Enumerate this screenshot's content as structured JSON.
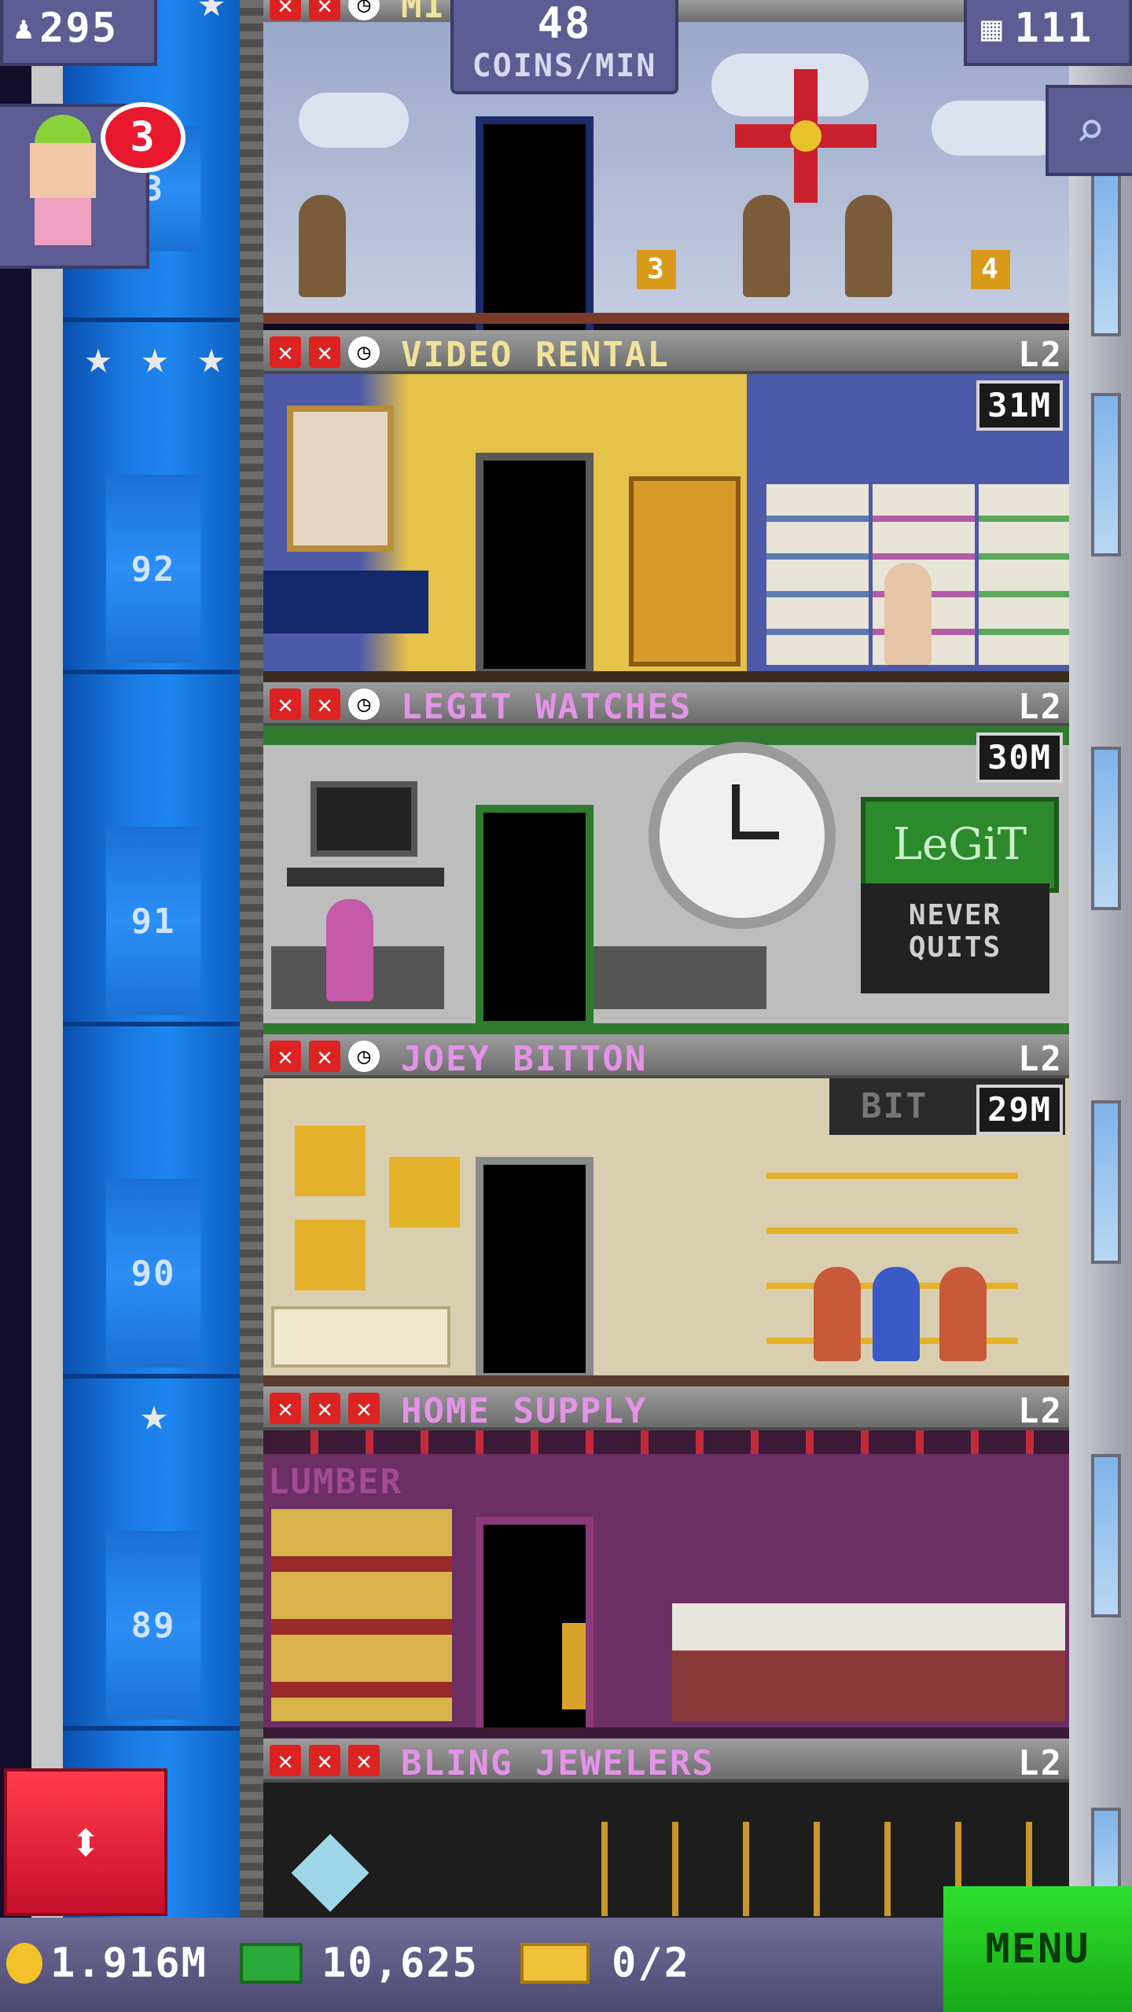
{
  "hud": {
    "population": "295",
    "coins_rate_value": "48",
    "coins_rate_unit": "COINS/MIN",
    "floor_count": "111",
    "notification_count": "3"
  },
  "floors": [
    {
      "name": "VIDEO RENTAL",
      "level": "L2",
      "amount": "31M",
      "shaft_number": "92",
      "marks": [
        "x",
        "x",
        "clock"
      ],
      "name_color": "#f0e39a"
    },
    {
      "name": "LEGIT WATCHES",
      "level": "L2",
      "amount": "30M",
      "shaft_number": "91",
      "marks": [
        "x",
        "x",
        "clock"
      ],
      "name_color": "#e493e8"
    },
    {
      "name": "JOEY BITTON",
      "level": "L2",
      "amount": "29M",
      "shaft_number": "90",
      "marks": [
        "x",
        "x",
        "clock"
      ],
      "name_color": "#e493e8"
    },
    {
      "name": "HOME SUPPLY",
      "level": "L2",
      "amount": "",
      "shaft_number": "89",
      "marks": [
        "x",
        "x",
        "x"
      ],
      "name_color": "#e493e8"
    },
    {
      "name": "BLING JEWELERS",
      "level": "L2",
      "amount": "",
      "shaft_number": "",
      "marks": [
        "x",
        "x",
        "x"
      ],
      "name_color": "#e493e8"
    }
  ],
  "top_floor": {
    "shaft_number": "3",
    "partial_name": "MI"
  },
  "room_text": {
    "legit_sign": "LeGiT",
    "legit_slogan": "NEVER QUITS",
    "bitton_sign": "BIT",
    "lumber_sign": "LUMBER",
    "floor_tags": [
      "3",
      "4"
    ]
  },
  "bottom_bar": {
    "coins": "1.916M",
    "bux": "10,625",
    "tickets": "0/2",
    "menu_label": "MENU"
  },
  "icons": {
    "population": "person-icon",
    "floors": "building-icon",
    "search": "magnifier-icon",
    "elevator": "up-down-arrows-icon",
    "coin": "coin-icon",
    "bux": "banknote-icon",
    "ticket": "ticket-icon"
  },
  "colors": {
    "shaft_blue": "#1a78e0",
    "menu_green": "#22c322",
    "elevator_red": "#e8182f",
    "x_red": "#dd2222",
    "name_pink": "#e493e8",
    "name_yellow": "#f0e39a"
  }
}
